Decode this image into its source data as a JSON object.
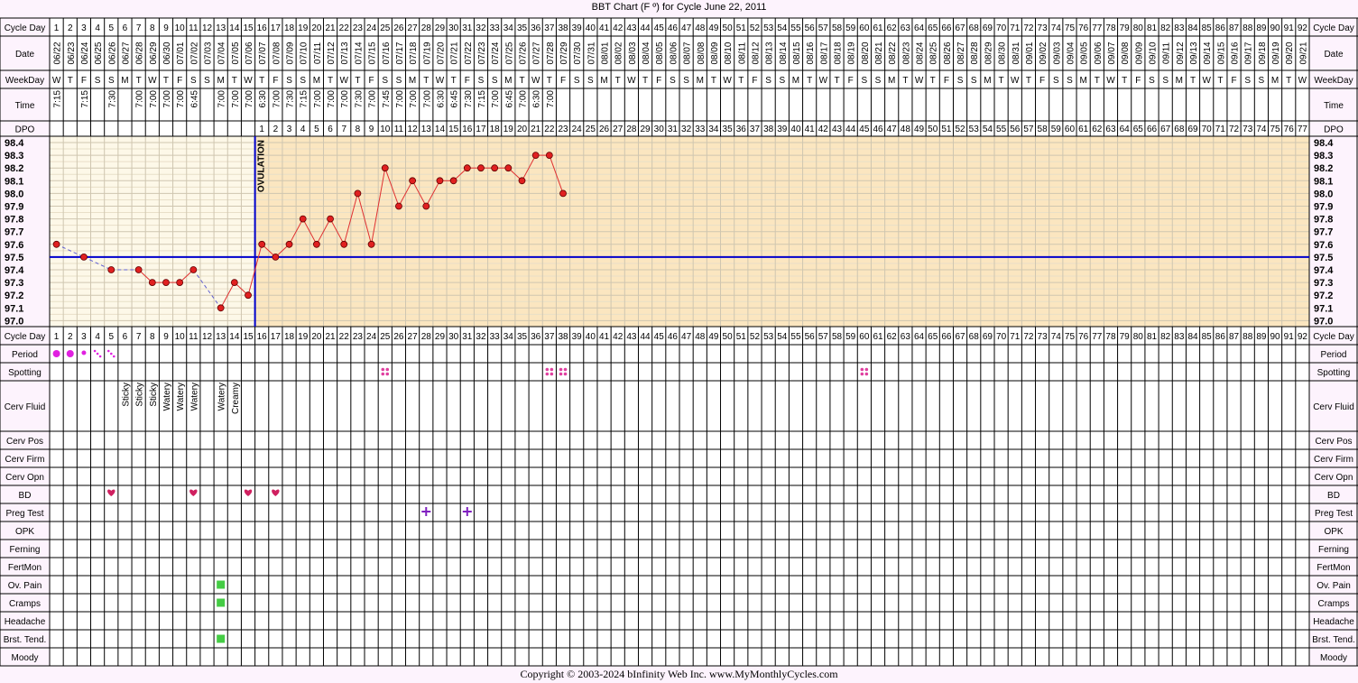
{
  "title": "BBT Chart (F º) for Cycle June 22, 2011",
  "copyright": "Copyright © 2003-2024 bInfinity Web Inc.      www.MyMonthlyCycles.com",
  "colors": {
    "pre_ovulation_bg": "#fdf8e8",
    "post_ovulation_bg": "#fbe6c0",
    "line": "#e03030",
    "point_fill": "#e02020",
    "coverline": "#0000cc",
    "ovulation_line": "#0000cc",
    "period": "#e020e0",
    "spotting": "#e040a0",
    "bd_heart": "#d02060",
    "preg_test": "#8020c0",
    "symptom": "#44cc44",
    "label_bg": "#fdf3fd"
  },
  "row_labels": {
    "cycle_day": "Cycle Day",
    "date": "Date",
    "weekday": "WeekDay",
    "time": "Time",
    "dpo": "DPO",
    "period": "Period",
    "spotting": "Spotting",
    "cerv_fluid": "Cerv Fluid",
    "cerv_pos": "Cerv Pos",
    "cerv_firm": "Cerv Firm",
    "cerv_opn": "Cerv Opn",
    "bd": "BD",
    "preg_test": "Preg Test",
    "opk": "OPK",
    "ferning": "Ferning",
    "fertmon": "FertMon",
    "ov_pain": "Ov. Pain",
    "cramps": "Cramps",
    "headache": "Headache",
    "brst_tend": "Brst. Tend.",
    "moody": "Moody"
  },
  "dates": [
    "06/22",
    "06/23",
    "06/24",
    "06/25",
    "06/26",
    "06/27",
    "06/28",
    "06/29",
    "06/30",
    "07/01",
    "07/02",
    "07/03",
    "07/04",
    "07/05",
    "07/06",
    "07/07",
    "07/08",
    "07/09",
    "07/10",
    "07/11",
    "07/12",
    "07/13",
    "07/14",
    "07/15",
    "07/16",
    "07/17",
    "07/18",
    "07/19",
    "07/20",
    "07/21",
    "07/22",
    "07/23",
    "07/24",
    "07/25",
    "07/26",
    "07/27",
    "07/28",
    "07/29",
    "07/30",
    "07/31",
    "08/01",
    "08/02",
    "08/03",
    "08/04",
    "08/05",
    "08/06",
    "08/07",
    "08/08",
    "08/09",
    "08/10",
    "08/11",
    "08/12",
    "08/13",
    "08/14",
    "08/15",
    "08/16",
    "08/17",
    "08/18",
    "08/19",
    "08/20",
    "08/21",
    "08/22",
    "08/23",
    "08/24",
    "08/25",
    "08/26",
    "08/27",
    "08/28",
    "08/29",
    "08/30",
    "08/31",
    "09/01",
    "09/02",
    "09/03",
    "09/04",
    "09/05",
    "09/06",
    "09/07",
    "09/08",
    "09/09",
    "09/10",
    "09/11",
    "09/12",
    "09/13",
    "09/14",
    "09/15",
    "09/16",
    "09/17",
    "09/18",
    "09/19",
    "09/20",
    "09/21"
  ],
  "weekdays": [
    "W",
    "T",
    "F",
    "S",
    "S",
    "M",
    "T",
    "W",
    "T",
    "F",
    "S",
    "S",
    "M",
    "T",
    "W",
    "T",
    "F",
    "S",
    "S",
    "M",
    "T",
    "W",
    "T",
    "F",
    "S",
    "S",
    "M",
    "T",
    "W",
    "T",
    "F",
    "S",
    "S",
    "M",
    "T",
    "W",
    "T",
    "F",
    "S",
    "S",
    "M",
    "T",
    "W",
    "T",
    "F",
    "S",
    "S",
    "M",
    "T",
    "W",
    "T",
    "F",
    "S",
    "S",
    "M",
    "T",
    "W",
    "T",
    "F",
    "S",
    "S",
    "M",
    "T",
    "W",
    "T",
    "F",
    "S",
    "S",
    "M",
    "T",
    "W",
    "T",
    "F",
    "S",
    "S",
    "M",
    "T",
    "W",
    "T",
    "F",
    "S",
    "S",
    "M",
    "T",
    "W",
    "T",
    "F",
    "S",
    "S",
    "M",
    "T",
    "W"
  ],
  "times": [
    "7:15",
    "",
    "7:15",
    "",
    "7:30",
    "",
    "7:00",
    "7:00",
    "7:00",
    "7:00",
    "6:45",
    "",
    "7:00",
    "7:00",
    "7:00",
    "6:30",
    "7:00",
    "7:30",
    "7:15",
    "7:00",
    "7:00",
    "7:00",
    "7:30",
    "7:00",
    "7:45",
    "7:00",
    "7:00",
    "7:00",
    "6:30",
    "6:45",
    "7:30",
    "7:15",
    "7:00",
    "6:45",
    "7:00",
    "6:30",
    "7:00",
    "",
    "",
    "",
    "",
    "",
    "",
    "",
    "",
    "",
    "",
    "",
    "",
    "",
    "",
    "",
    "",
    "",
    "",
    "",
    "",
    "",
    "",
    "",
    "",
    "",
    "",
    "",
    "",
    "",
    "",
    "",
    "",
    "",
    "",
    "",
    "",
    "",
    "",
    "",
    "",
    "",
    "",
    "",
    "",
    "",
    "",
    "",
    "",
    "",
    "",
    "",
    "",
    "",
    ""
  ],
  "dpo_start_day": 16,
  "dpo_count": 77,
  "cerv_fluid": [
    "",
    "",
    "",
    "",
    "",
    "Sticky",
    "Sticky",
    "Sticky",
    "Watery",
    "Watery",
    "Watery",
    "",
    "Watery",
    "Creamy",
    "",
    "",
    "",
    "",
    "",
    "",
    "",
    "",
    "",
    "",
    "",
    "",
    "",
    "",
    "",
    "",
    "",
    "",
    "",
    "",
    "",
    "",
    "",
    "",
    "",
    "",
    "",
    "",
    "",
    "",
    "",
    "",
    "",
    "",
    "",
    "",
    "",
    "",
    "",
    "",
    "",
    "",
    "",
    "",
    "",
    "",
    "",
    "",
    "",
    "",
    "",
    "",
    "",
    "",
    "",
    "",
    "",
    "",
    "",
    "",
    "",
    "",
    "",
    "",
    "",
    "",
    "",
    "",
    "",
    "",
    "",
    "",
    "",
    ""
  ],
  "period": [
    {
      "day": 1,
      "flow": "heavy"
    },
    {
      "day": 2,
      "flow": "heavy"
    },
    {
      "day": 3,
      "flow": "medium"
    },
    {
      "day": 4,
      "flow": "light"
    },
    {
      "day": 5,
      "flow": "light"
    }
  ],
  "spotting_days": [
    25,
    37,
    38,
    60
  ],
  "bd_days": [
    5,
    11,
    15,
    17
  ],
  "preg_test_days": [
    28,
    31
  ],
  "ov_pain_days": [
    13
  ],
  "cramps_days": [
    13
  ],
  "brst_tend_days": [
    13
  ],
  "ovulation": {
    "day": 15,
    "label": "OVULATION"
  },
  "chart_data": {
    "type": "line",
    "title": "BBT Chart (F º) for Cycle June 22, 2011",
    "x_label": "Cycle Day",
    "x_range": [
      1,
      92
    ],
    "y_ticks": [
      "98.4",
      "98.3",
      "98.2",
      "98.1",
      "98.0",
      "97.9",
      "97.8",
      "97.7",
      "97.6",
      "97.5",
      "97.4",
      "97.3",
      "97.2",
      "97.1",
      "97.0"
    ],
    "ylim": [
      97.0,
      98.4
    ],
    "coverline": 97.5,
    "temps": [
      {
        "day": 1,
        "temp": 97.6
      },
      {
        "day": 3,
        "temp": 97.5
      },
      {
        "day": 5,
        "temp": 97.4
      },
      {
        "day": 7,
        "temp": 97.4
      },
      {
        "day": 8,
        "temp": 97.3
      },
      {
        "day": 9,
        "temp": 97.3
      },
      {
        "day": 10,
        "temp": 97.3
      },
      {
        "day": 11,
        "temp": 97.4
      },
      {
        "day": 13,
        "temp": 97.1
      },
      {
        "day": 14,
        "temp": 97.3
      },
      {
        "day": 15,
        "temp": 97.2
      },
      {
        "day": 16,
        "temp": 97.6
      },
      {
        "day": 17,
        "temp": 97.5
      },
      {
        "day": 18,
        "temp": 97.6
      },
      {
        "day": 19,
        "temp": 97.8
      },
      {
        "day": 20,
        "temp": 97.6
      },
      {
        "day": 21,
        "temp": 97.8
      },
      {
        "day": 22,
        "temp": 97.6
      },
      {
        "day": 23,
        "temp": 98.0
      },
      {
        "day": 24,
        "temp": 97.6
      },
      {
        "day": 25,
        "temp": 98.2
      },
      {
        "day": 26,
        "temp": 97.9
      },
      {
        "day": 27,
        "temp": 98.1
      },
      {
        "day": 28,
        "temp": 97.9
      },
      {
        "day": 29,
        "temp": 98.1
      },
      {
        "day": 30,
        "temp": 98.1
      },
      {
        "day": 31,
        "temp": 98.2
      },
      {
        "day": 32,
        "temp": 98.2
      },
      {
        "day": 33,
        "temp": 98.2
      },
      {
        "day": 34,
        "temp": 98.2
      },
      {
        "day": 35,
        "temp": 98.1
      },
      {
        "day": 36,
        "temp": 98.3
      },
      {
        "day": 37,
        "temp": 98.3
      },
      {
        "day": 38,
        "temp": 98.0
      }
    ]
  }
}
